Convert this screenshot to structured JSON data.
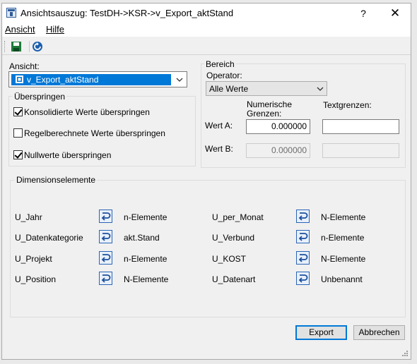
{
  "window": {
    "title": "Ansichtsauszug:  TestDH->KSR->v_Export_aktStand",
    "help": "?",
    "close": "✕"
  },
  "menu": {
    "ansicht": "Ansicht",
    "hilfe": "Hilfe"
  },
  "toolbar": {
    "icons": [
      "save-icon",
      "refresh-icon"
    ]
  },
  "view": {
    "label": "Ansicht:",
    "selected": "v_Export_aktStand"
  },
  "skip": {
    "title": "Überspringen",
    "options": [
      {
        "label": "Konsolidierte Werte überspringen",
        "checked": true
      },
      {
        "label": "Regelberechnete Werte überspringen",
        "checked": false
      },
      {
        "label": "Nullwerte überspringen",
        "checked": true
      }
    ]
  },
  "range": {
    "title": "Bereich",
    "operator_label": "Operator:",
    "operator_value": "Alle Werte",
    "numeric_header": "Numerische\nGrenzen:",
    "text_header": "Textgrenzen:",
    "value_a_label": "Wert A:",
    "value_a_numeric": "0.000000",
    "value_a_text": "",
    "value_b_label": "Wert B:",
    "value_b_numeric": "0.000000",
    "value_b_text": ""
  },
  "dimensions": {
    "title": "Dimensionselemente",
    "left": [
      {
        "name": "U_Jahr",
        "value": "n-Elemente"
      },
      {
        "name": "U_Datenkategorie",
        "value": "akt.Stand"
      },
      {
        "name": "U_Projekt",
        "value": "n-Elemente"
      },
      {
        "name": "U_Position",
        "value": "N-Elemente"
      }
    ],
    "right": [
      {
        "name": "U_per_Monat",
        "value": "N-Elemente"
      },
      {
        "name": "U_Verbund",
        "value": "n-Elemente"
      },
      {
        "name": "U_KOST",
        "value": "N-Elemente"
      },
      {
        "name": "U_Datenart",
        "value": "Unbenannt"
      }
    ]
  },
  "buttons": {
    "export": "Export",
    "cancel": "Abbrechen"
  },
  "colors": {
    "selection": "#0078d7",
    "dim_button_border": "#2b64b5"
  }
}
